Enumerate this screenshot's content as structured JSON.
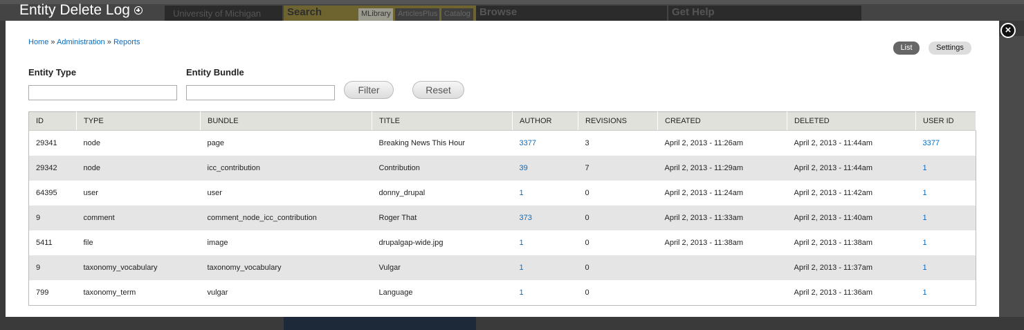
{
  "background": {
    "university_label": "University of Michigan",
    "search_label": "Search",
    "search_tabs": [
      "MLibrary",
      "ArticlesPlus",
      "Catalog"
    ],
    "browse_label": "Browse",
    "help_label": "Get Help"
  },
  "overlay": {
    "title": "Entity Delete Log",
    "close_glyph": "×"
  },
  "breadcrumb": {
    "items": [
      "Home",
      "Administration",
      "Reports"
    ],
    "separator": "»"
  },
  "tabs": {
    "list": "List",
    "settings": "Settings"
  },
  "filters": {
    "entity_type_label": "Entity Type",
    "entity_type_value": "",
    "entity_bundle_label": "Entity Bundle",
    "entity_bundle_value": "",
    "filter_button": "Filter",
    "reset_button": "Reset"
  },
  "table": {
    "columns": [
      "ID",
      "TYPE",
      "BUNDLE",
      "TITLE",
      "AUTHOR",
      "REVISIONS",
      "CREATED",
      "DELETED",
      "USER ID"
    ],
    "rows": [
      [
        "29341",
        "node",
        "page",
        "Breaking News This Hour",
        "3377",
        "3",
        "April 2, 2013 - 11:26am",
        "April 2, 2013 - 11:44am",
        "3377"
      ],
      [
        "29342",
        "node",
        "icc_contribution",
        "Contribution",
        "39",
        "7",
        "April 2, 2013 - 11:29am",
        "April 2, 2013 - 11:44am",
        "1"
      ],
      [
        "64395",
        "user",
        "user",
        "donny_drupal",
        "1",
        "0",
        "April 2, 2013 - 11:24am",
        "April 2, 2013 - 11:42am",
        "1"
      ],
      [
        "9",
        "comment",
        "comment_node_icc_contribution",
        "Roger That",
        "373",
        "0",
        "April 2, 2013 - 11:33am",
        "April 2, 2013 - 11:40am",
        "1"
      ],
      [
        "5411",
        "file",
        "image",
        "drupalgap-wide.jpg",
        "1",
        "0",
        "April 2, 2013 - 11:38am",
        "April 2, 2013 - 11:38am",
        "1"
      ],
      [
        "9",
        "taxonomy_vocabulary",
        "taxonomy_vocabulary",
        "Vulgar",
        "1",
        "0",
        "",
        "April 2, 2013 - 11:37am",
        "1"
      ],
      [
        "799",
        "taxonomy_term",
        "vulgar",
        "Language",
        "1",
        "0",
        "",
        "April 2, 2013 - 11:36am",
        "1"
      ]
    ]
  },
  "colors": {
    "link": "#0b6bbd",
    "header_bg": "#e1e1dc",
    "zebra": "#e5e5e5",
    "active_tab": "#666666"
  }
}
